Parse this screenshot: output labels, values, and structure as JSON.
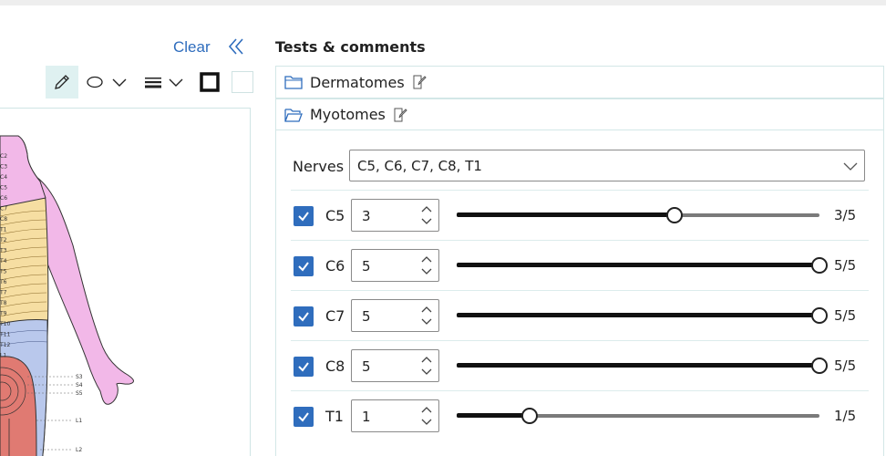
{
  "left": {
    "clear_label": "Clear"
  },
  "diagram": {
    "labels_left": [
      "C2",
      "C3",
      "C4",
      "C5",
      "C6",
      "C7",
      "C8",
      "T1",
      "T2",
      "T3",
      "T4",
      "T5",
      "T6",
      "T7",
      "T8",
      "T9",
      "T10",
      "T11",
      "T12",
      "L1"
    ],
    "labels_right": [
      "S3",
      "S4",
      "S5",
      "L1",
      "L2"
    ]
  },
  "panel": {
    "title": "Tests & comments",
    "sections": [
      {
        "label": "Dermatomes"
      },
      {
        "label": "Myotomes"
      }
    ],
    "nerves": {
      "label": "Nerves",
      "value": "C5, C6, C7, C8, T1"
    },
    "rows": [
      {
        "label": "C5",
        "value": "3",
        "max": 5,
        "display": "3/5",
        "checked": true
      },
      {
        "label": "C6",
        "value": "5",
        "max": 5,
        "display": "5/5",
        "checked": true
      },
      {
        "label": "C7",
        "value": "5",
        "max": 5,
        "display": "5/5",
        "checked": true
      },
      {
        "label": "C8",
        "value": "5",
        "max": 5,
        "display": "5/5",
        "checked": true
      },
      {
        "label": "T1",
        "value": "1",
        "max": 5,
        "display": "1/5",
        "checked": true
      }
    ]
  },
  "colors": {
    "accent": "#2f6dbd",
    "dermatome_pink": "#f2b8e8",
    "dermatome_yellow": "#f6dea2",
    "dermatome_blue": "#b9c8ec",
    "dermatome_red": "#e07a72"
  }
}
